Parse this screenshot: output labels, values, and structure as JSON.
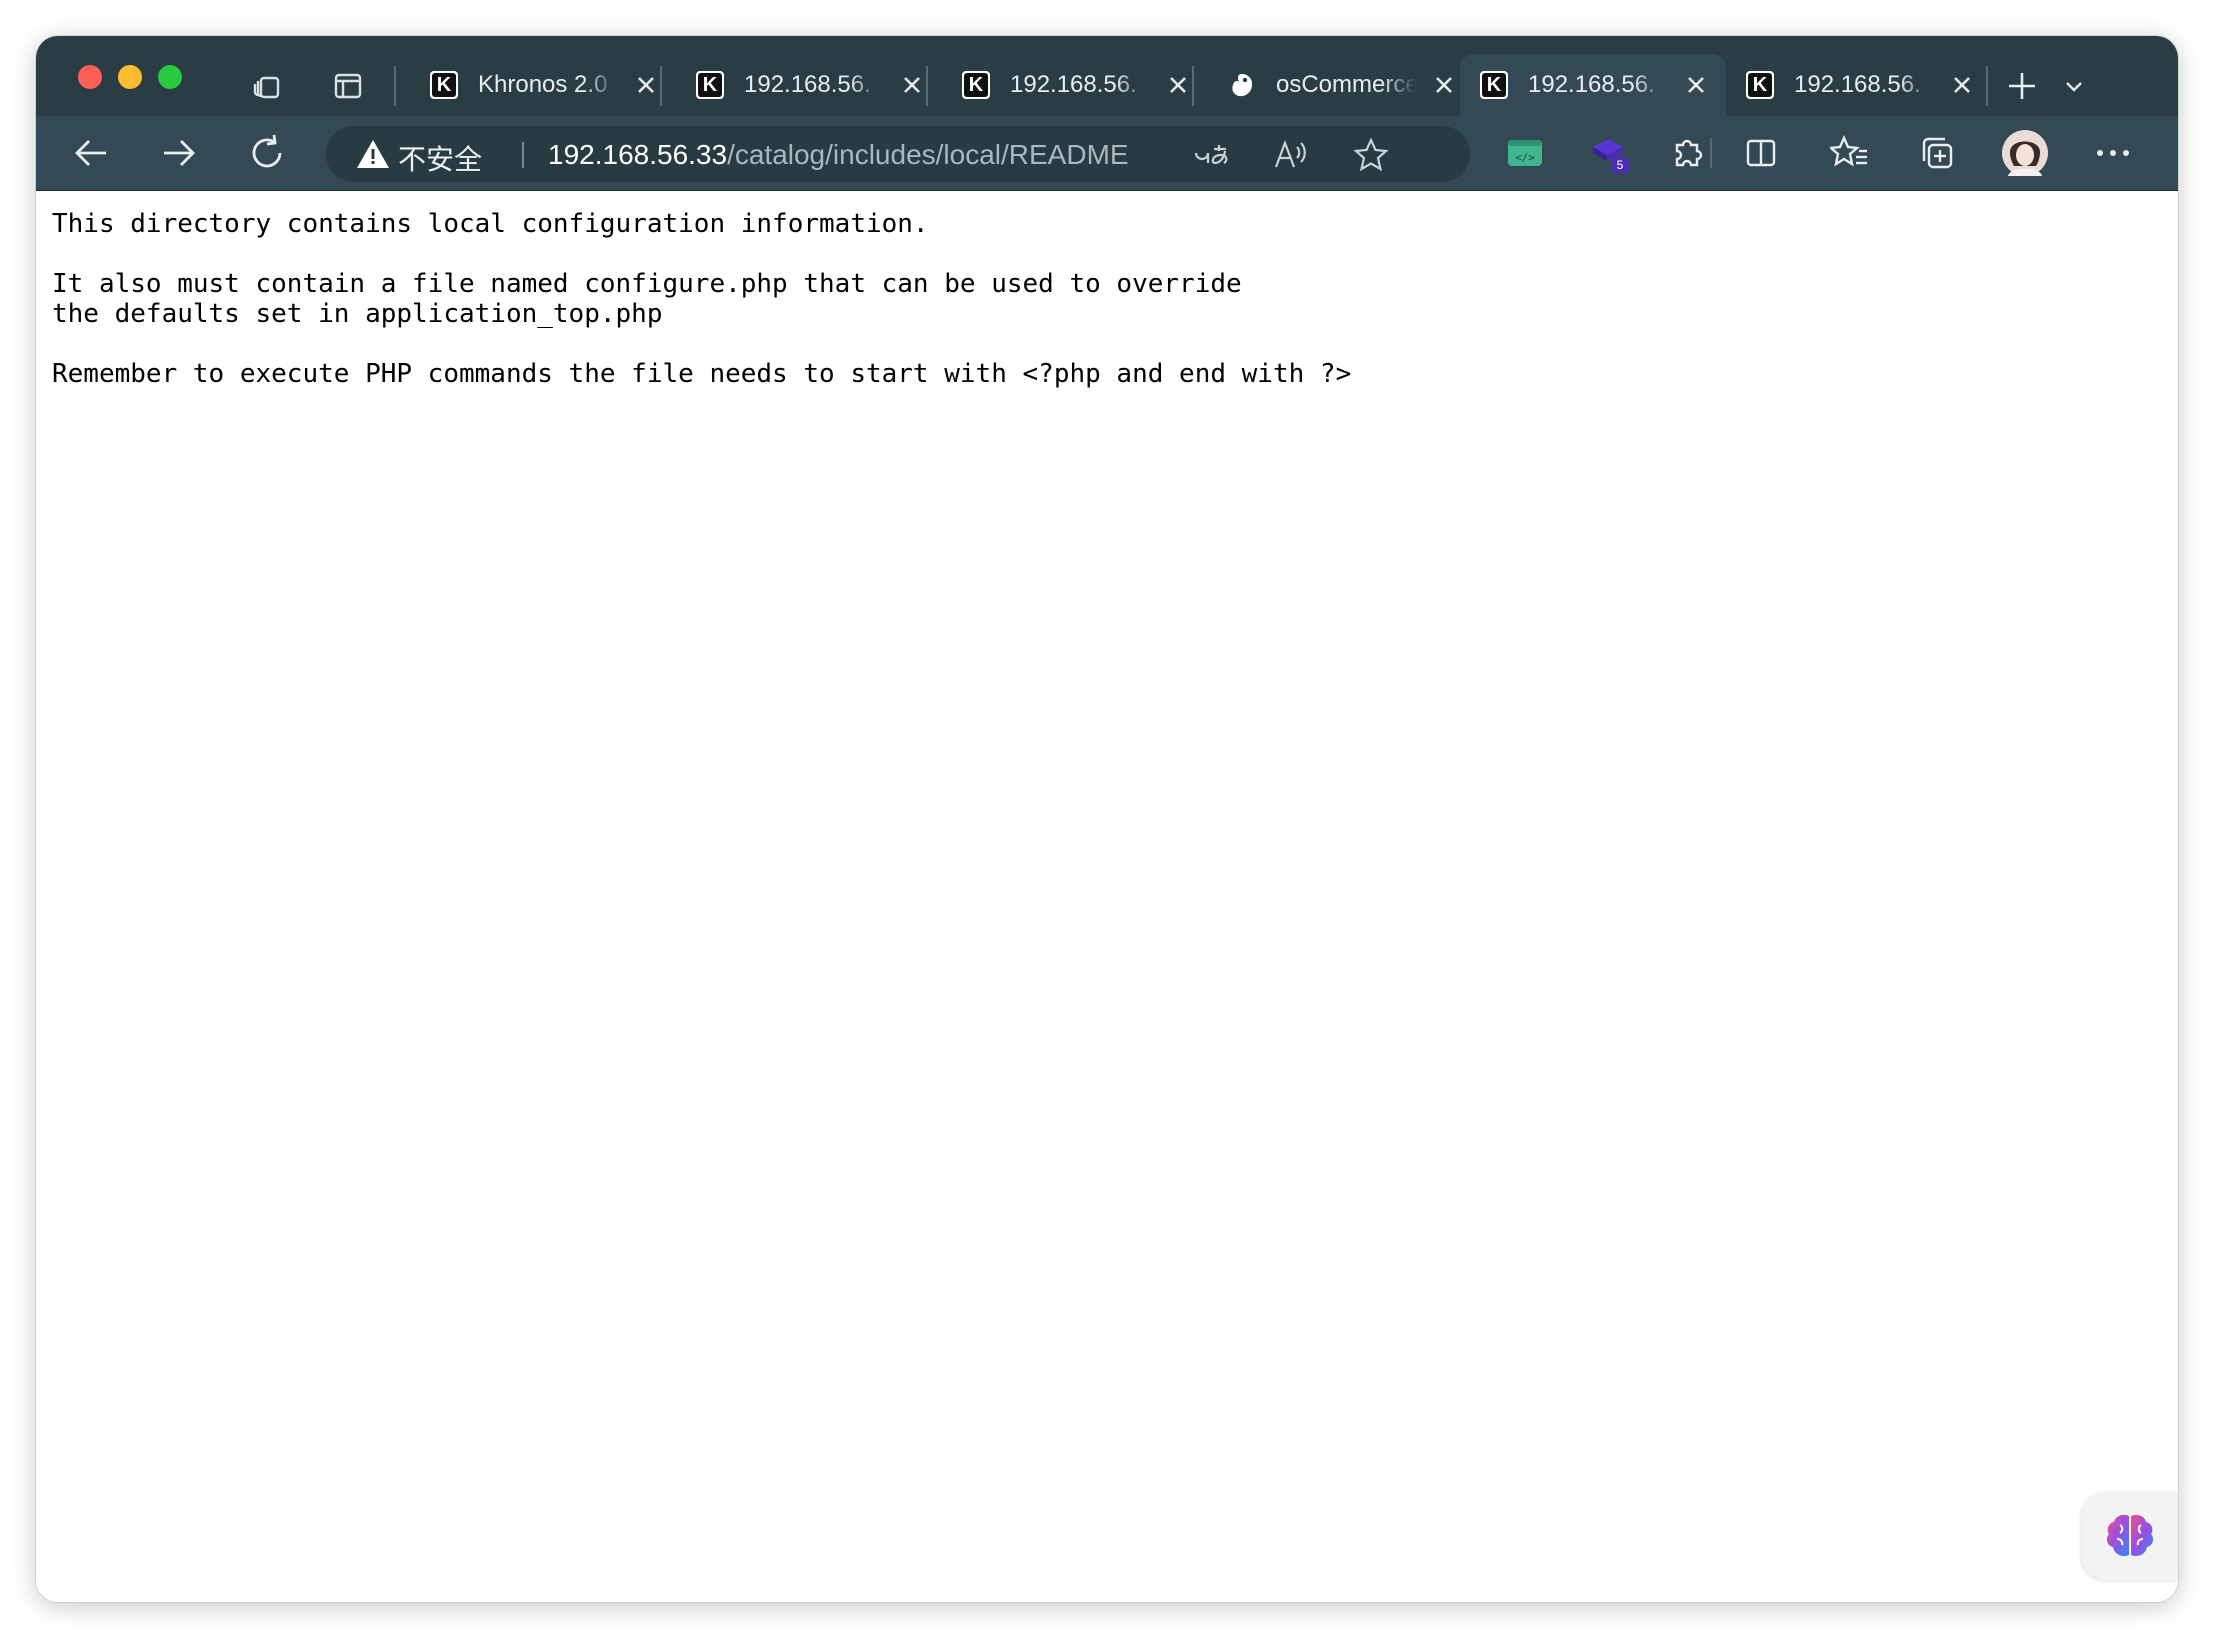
{
  "browser": {
    "tabs": [
      {
        "title": "Khronos 2.0",
        "favicon": "k-logo-icon",
        "active": false
      },
      {
        "title": "192.168.56.",
        "favicon": "k-logo-icon",
        "active": false
      },
      {
        "title": "192.168.56.",
        "favicon": "k-logo-icon",
        "active": false
      },
      {
        "title": "osCommerce",
        "favicon": "oscommerce-icon",
        "active": false
      },
      {
        "title": "192.168.56.",
        "favicon": "k-logo-icon",
        "active": true
      },
      {
        "title": "192.168.56.",
        "favicon": "k-logo-icon",
        "active": false
      }
    ],
    "address_bar": {
      "security_label": "不安全",
      "url_host": "192.168.56.33",
      "url_path": "/catalog/includes/local/README"
    },
    "extension_badge": "5"
  },
  "page": {
    "text": "This directory contains local configuration information.\n\nIt also must contain a file named configure.php that can be used to override\nthe defaults set in application_top.php\n\nRemember to execute PHP commands the file needs to start with <?php and end with ?>"
  },
  "colors": {
    "tabstrip_bg": "#2a3c44",
    "toolbar_bg": "#334a54",
    "extension_green": "#3fb68b",
    "extension_purple": "#4b2bb0"
  }
}
